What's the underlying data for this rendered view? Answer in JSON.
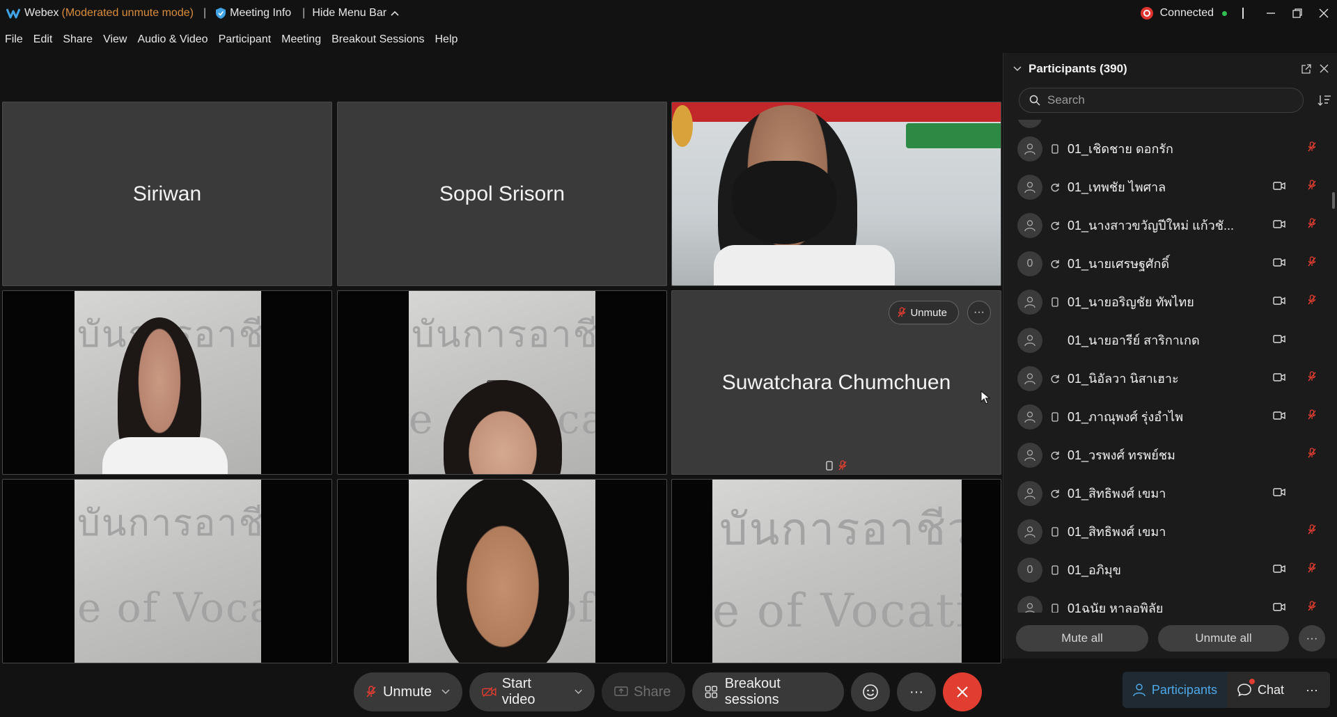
{
  "titlebar": {
    "app_name": "Webex",
    "mode": "(Moderated unmute mode)",
    "separator": "|",
    "meeting_info": "Meeting Info",
    "hide_menu_bar": "Hide Menu Bar",
    "status": "Connected"
  },
  "menu": [
    "File",
    "Edit",
    "Share",
    "View",
    "Audio & Video",
    "Participant",
    "Meeting",
    "Breakout Sessions",
    "Help"
  ],
  "tiles": {
    "t1_name": "Siriwan",
    "t2_name": "Sopol Srisorn",
    "t6_name": "Suwatchara Chumchuen",
    "t6_unmute": "Unmute",
    "t6_more": "···",
    "wall_text_1": "บันการอาชีว",
    "wall_text_2": "e of Vocati"
  },
  "controls": {
    "unmute": "Unmute",
    "start_video": "Start video",
    "share": "Share",
    "breakout": "Breakout sessions",
    "more": "···"
  },
  "panel": {
    "title": "Participants (390)",
    "search_placeholder": "Search",
    "mute_all": "Mute all",
    "unmute_all": "Unmute all",
    "more": "···",
    "participants": [
      {
        "name": "01_เชิดชาย ดอกรัก",
        "avatar": "",
        "device": "phone",
        "video": false,
        "mic_muted": true
      },
      {
        "name": "01_เทพชัย ไพศาล",
        "avatar": "",
        "device": "sync",
        "video": true,
        "mic_muted": true
      },
      {
        "name": "01_นางสาวขวัญปีใหม่ แก้วชั...",
        "avatar": "",
        "device": "sync",
        "video": true,
        "mic_muted": true
      },
      {
        "name": "01_นายเศรษฐศักดิ์",
        "avatar": "0",
        "device": "sync",
        "video": true,
        "mic_muted": true
      },
      {
        "name": "01_นายอริญชัย ทัพไทย",
        "avatar": "",
        "device": "phone",
        "video": true,
        "mic_muted": true
      },
      {
        "name": "01_นายอารีย์ สาริกาเกด",
        "avatar": "",
        "device": "",
        "video": true,
        "mic_muted": false
      },
      {
        "name": "01_นิอัลวา นิสาเฮาะ",
        "avatar": "",
        "device": "sync",
        "video": true,
        "mic_muted": true
      },
      {
        "name": "01_ภาณุพงศ์ รุ่งอำไพ",
        "avatar": "",
        "device": "phone",
        "video": true,
        "mic_muted": true
      },
      {
        "name": "01_วรพงศ์ ทรพย์ชม",
        "avatar": "",
        "device": "sync",
        "video": false,
        "mic_muted": true
      },
      {
        "name": "01_สิทธิพงศ์ เขมา",
        "avatar": "",
        "device": "sync",
        "video": true,
        "mic_muted": false
      },
      {
        "name": "01_สิทธิพงศ์ เขมา",
        "avatar": "",
        "device": "phone",
        "video": false,
        "mic_muted": true
      },
      {
        "name": "01_อภิมุข",
        "avatar": "0",
        "device": "phone",
        "video": true,
        "mic_muted": true
      },
      {
        "name": "01ฉนัย หาลอพิลัย",
        "avatar": "",
        "device": "phone",
        "video": true,
        "mic_muted": true
      }
    ]
  },
  "bottom_tabs": {
    "participants": "Participants",
    "chat": "Chat",
    "more": "···"
  },
  "colors": {
    "accent": "#4fa9e8",
    "mute_red": "#e23d31",
    "mode_orange": "#d98c3a",
    "connected_green": "#2fbf52"
  }
}
